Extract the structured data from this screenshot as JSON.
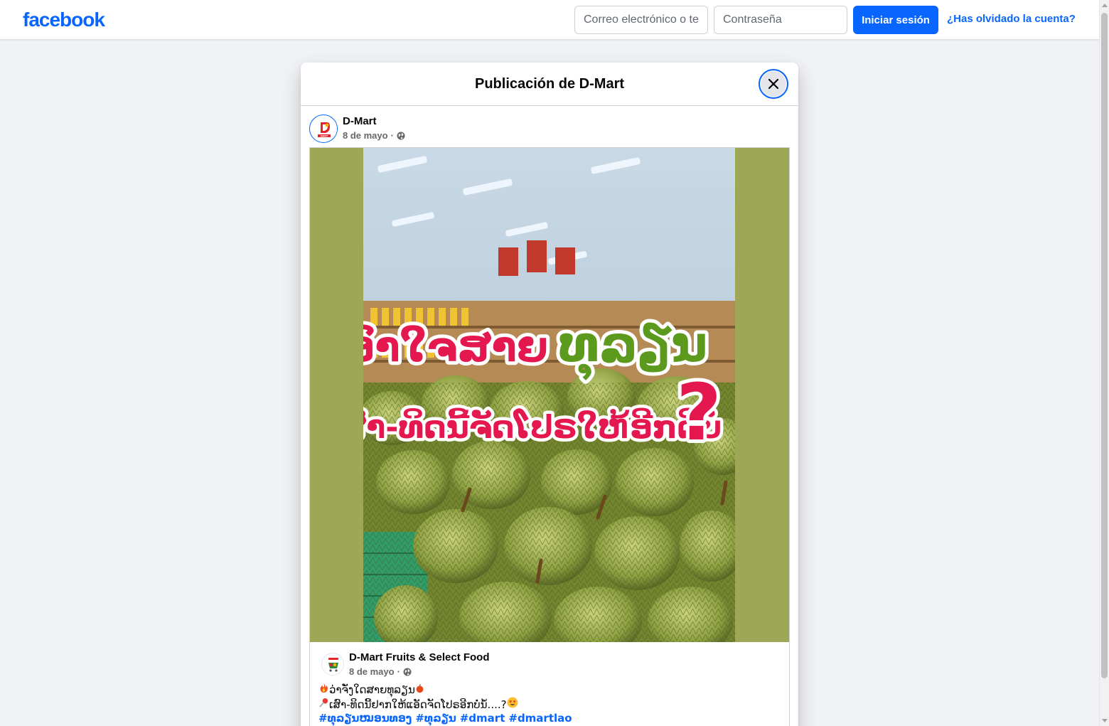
{
  "topbar": {
    "logo": "facebook",
    "email_placeholder": "Correo electrónico o teléfono",
    "password_placeholder": "Contraseña",
    "login_label": "Iniciar sesión",
    "forgot_label": "¿Has olvidado la cuenta?"
  },
  "dialog": {
    "title": "Publicación de D-Mart",
    "post": {
      "author": "D-Mart",
      "date": "8 de mayo",
      "separator": "·",
      "image": {
        "headline_line1": "ເອົາໃຈສາຍ",
        "headline_line1_accent": "ທຸລຽນ",
        "headline_line2": "ເສົາ-ທິດນີ້ຈັດໂປຣໃຫ້ອີກດີບໍ່",
        "question_mark": "?"
      },
      "shared": {
        "author": "D-Mart Fruits & Select Food",
        "date": "8 de mayo",
        "separator": "·",
        "caption_line1": "ວ່າຈັ່ງໃດສາຍທຸລຽນ",
        "caption_line2": "ເສົາ-ທິດນີ້ຢາກໃຫ້ແອັດຈັດໂປຣອີກບໍ່ນໍ້....?",
        "hashtags": [
          "#ທຸລຽນໝອນທອງ",
          "#ທຸລຽນ",
          "#dmart",
          "#dmartlao"
        ]
      }
    }
  },
  "colors": {
    "brand": "#0866ff",
    "image_side": "#9ea756",
    "headline_red": "#e4174f",
    "headline_green": "#5b9a1c"
  },
  "icons": [
    "close-icon",
    "globe-icon",
    "fire-emoji",
    "pin-emoji",
    "heart-eyes-emoji"
  ]
}
